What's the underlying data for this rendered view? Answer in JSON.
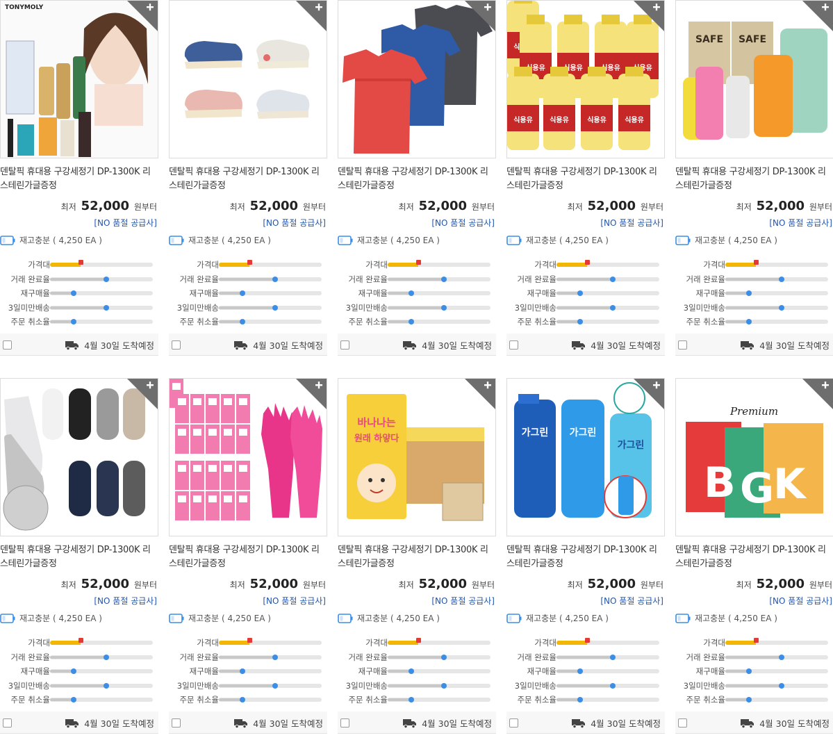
{
  "colors": {
    "price_fill": "#f2b705",
    "price_flag": "#e53935",
    "metric_dot": "#3b8ee6",
    "supplier_text": "#2255aa"
  },
  "products": [
    {
      "image_icon": "tonymoly-cosmetics-image",
      "image_text": "TONYMOLY",
      "title": "덴탈픽 휴대용 구강세정기 DP-1300K 리스테린가글증정",
      "price_prefix": "최저",
      "price": "52,000",
      "price_suffix": "원부터",
      "supplier": "[NO 품절 공급사]",
      "stock": "재고충분 ( 4,250 EA )",
      "metrics": [
        {
          "label": "가격대",
          "value": 0.3
        },
        {
          "label": "거래 완료율",
          "value": 0.55
        },
        {
          "label": "재구매율",
          "value": 0.23
        },
        {
          "label": "3일미만배송",
          "value": 0.55
        },
        {
          "label": "주문 취소율",
          "value": 0.23
        }
      ],
      "delivery": "4월 30일 도착예정"
    },
    {
      "image_icon": "kids-shoes-image",
      "image_text": "",
      "title": "덴탈픽 휴대용 구강세정기 DP-1300K 리스테린가글증정",
      "price_prefix": "최저",
      "price": "52,000",
      "price_suffix": "원부터",
      "supplier": "[NO 품절 공급사]",
      "stock": "재고충분 ( 4,250 EA )",
      "metrics": [
        {
          "label": "가격대",
          "value": 0.3
        },
        {
          "label": "거래 완료율",
          "value": 0.55
        },
        {
          "label": "재구매율",
          "value": 0.23
        },
        {
          "label": "3일미만배송",
          "value": 0.55
        },
        {
          "label": "주문 취소율",
          "value": 0.23
        }
      ],
      "delivery": "4월 30일 도착예정"
    },
    {
      "image_icon": "tshirts-image",
      "image_text": "",
      "title": "덴탈픽 휴대용 구강세정기 DP-1300K 리스테린가글증정",
      "price_prefix": "최저",
      "price": "52,000",
      "price_suffix": "원부터",
      "supplier": "[NO 품절 공급사]",
      "stock": "재고충분 ( 4,250 EA )",
      "metrics": [
        {
          "label": "가격대",
          "value": 0.3
        },
        {
          "label": "거래 완료율",
          "value": 0.55
        },
        {
          "label": "재구매율",
          "value": 0.23
        },
        {
          "label": "3일미만배송",
          "value": 0.55
        },
        {
          "label": "주문 취소율",
          "value": 0.23
        }
      ],
      "delivery": "4월 30일 도착예정"
    },
    {
      "image_icon": "cooking-oil-image",
      "image_text": "식용유",
      "title": "덴탈픽 휴대용 구강세정기 DP-1300K 리스테린가글증정",
      "price_prefix": "최저",
      "price": "52,000",
      "price_suffix": "원부터",
      "supplier": "[NO 품절 공급사]",
      "stock": "재고충분 ( 4,250 EA )",
      "metrics": [
        {
          "label": "가격대",
          "value": 0.3
        },
        {
          "label": "거래 완료율",
          "value": 0.55
        },
        {
          "label": "재구매율",
          "value": 0.23
        },
        {
          "label": "3일미만배송",
          "value": 0.55
        },
        {
          "label": "주문 취소율",
          "value": 0.23
        }
      ],
      "delivery": "4월 30일 도착예정"
    },
    {
      "image_icon": "detergent-bottles-image",
      "image_text": "SAFE",
      "title": "덴탈픽 휴대용 구강세정기 DP-1300K 리스테린가글증정",
      "price_prefix": "최저",
      "price": "52,000",
      "price_suffix": "원부터",
      "supplier": "[NO 품절 공급사]",
      "stock": "재고충분 ( 4,250 EA )",
      "metrics": [
        {
          "label": "가격대",
          "value": 0.3
        },
        {
          "label": "거래 완료율",
          "value": 0.55
        },
        {
          "label": "재구매율",
          "value": 0.23
        },
        {
          "label": "3일미만배송",
          "value": 0.55
        },
        {
          "label": "주문 취소율",
          "value": 0.23
        }
      ],
      "delivery": "4월 30일 도착예정"
    },
    {
      "image_icon": "socks-image",
      "image_text": "",
      "title": "덴탈픽 휴대용 구강세정기 DP-1300K 리스테린가글증정",
      "price_prefix": "최저",
      "price": "52,000",
      "price_suffix": "원부터",
      "supplier": "[NO 품절 공급사]",
      "stock": "재고충분 ( 4,250 EA )",
      "metrics": [
        {
          "label": "가격대",
          "value": 0.3
        },
        {
          "label": "거래 완료율",
          "value": 0.55
        },
        {
          "label": "재구매율",
          "value": 0.23
        },
        {
          "label": "3일미만배송",
          "value": 0.55
        },
        {
          "label": "주문 취소율",
          "value": 0.23
        }
      ],
      "delivery": "4월 30일 도착예정"
    },
    {
      "image_icon": "rubber-gloves-image",
      "image_text": "",
      "title": "덴탈픽 휴대용 구강세정기 DP-1300K 리스테린가글증정",
      "price_prefix": "최저",
      "price": "52,000",
      "price_suffix": "원부터",
      "supplier": "[NO 품절 공급사]",
      "stock": "재고충분 ( 4,250 EA )",
      "metrics": [
        {
          "label": "가격대",
          "value": 0.3
        },
        {
          "label": "거래 완료율",
          "value": 0.55
        },
        {
          "label": "재구매율",
          "value": 0.23
        },
        {
          "label": "3일미만배송",
          "value": 0.55
        },
        {
          "label": "주문 취소율",
          "value": 0.23
        }
      ],
      "delivery": "4월 30일 도착예정"
    },
    {
      "image_icon": "banana-milk-image",
      "image_text": "바나나는 원래 하얗다",
      "title": "덴탈픽 휴대용 구강세정기 DP-1300K 리스테린가글증정",
      "price_prefix": "최저",
      "price": "52,000",
      "price_suffix": "원부터",
      "supplier": "[NO 품절 공급사]",
      "stock": "재고충분 ( 4,250 EA )",
      "metrics": [
        {
          "label": "가격대",
          "value": 0.3
        },
        {
          "label": "거래 완료율",
          "value": 0.55
        },
        {
          "label": "재구매율",
          "value": 0.23
        },
        {
          "label": "3일미만배송",
          "value": 0.55
        },
        {
          "label": "주문 취소율",
          "value": 0.23
        }
      ],
      "delivery": "4월 30일 도착예정"
    },
    {
      "image_icon": "mouthwash-image",
      "image_text": "가그린",
      "title": "덴탈픽 휴대용 구강세정기 DP-1300K 리스테린가글증정",
      "price_prefix": "최저",
      "price": "52,000",
      "price_suffix": "원부터",
      "supplier": "[NO 품절 공급사]",
      "stock": "재고충분 ( 4,250 EA )",
      "metrics": [
        {
          "label": "가격대",
          "value": 0.3
        },
        {
          "label": "거래 완료율",
          "value": 0.55
        },
        {
          "label": "재구매율",
          "value": 0.23
        },
        {
          "label": "3일미만배송",
          "value": 0.55
        },
        {
          "label": "주문 취소율",
          "value": 0.23
        }
      ],
      "delivery": "4월 30일 도착예정"
    },
    {
      "image_icon": "premium-pouches-image",
      "image_text": "Premium",
      "title": "덴탈픽 휴대용 구강세정기 DP-1300K 리스테린가글증정",
      "price_prefix": "최저",
      "price": "52,000",
      "price_suffix": "원부터",
      "supplier": "[NO 품절 공급사]",
      "stock": "재고충분 ( 4,250 EA )",
      "metrics": [
        {
          "label": "가격대",
          "value": 0.3
        },
        {
          "label": "거래 완료율",
          "value": 0.55
        },
        {
          "label": "재구매율",
          "value": 0.23
        },
        {
          "label": "3일미만배송",
          "value": 0.55
        },
        {
          "label": "주문 취소율",
          "value": 0.23
        }
      ],
      "delivery": "4월 30일 도착예정"
    }
  ]
}
